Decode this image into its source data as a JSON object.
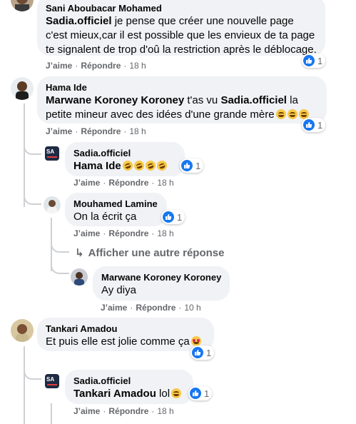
{
  "comments": [
    {
      "author": "Sani Aboubacar Mohamed",
      "lines": [
        [
          {
            "t": "Sadia.officiel",
            "m": true
          },
          {
            "t": " je pense que créer une nouvelle page"
          }
        ],
        [
          {
            "t": "c'est mieux,car il est possible que les envieux de ta page"
          }
        ],
        [
          {
            "t": "te signalent de trop d'oû la restriction après le déblocage."
          }
        ]
      ],
      "like_label": "J’aime",
      "reply_label": "Répondre",
      "time": "18 h",
      "reactions": "1"
    },
    {
      "author": "Hama Ide",
      "lines": [
        [
          {
            "t": "Marwane Koroney Koroney",
            "m": true
          },
          {
            "t": " t'as vu "
          },
          {
            "t": "Sadia.officiel",
            "m": true
          },
          {
            "t": " la"
          }
        ],
        [
          {
            "t": "petite mineur avec des idées d'une grande mère"
          }
        ]
      ],
      "emojis": [
        "laugh-cry-emoji",
        "laugh-cry-emoji",
        "laugh-cry-emoji"
      ],
      "like_label": "J’aime",
      "reply_label": "Répondre",
      "time": "18 h",
      "reactions": "1"
    },
    {
      "author": "Sadia.officiel",
      "lines": [
        [
          {
            "t": "Hama Ide",
            "m": true
          }
        ]
      ],
      "emojis": [
        "rofl-emoji",
        "rofl-emoji",
        "rofl-emoji",
        "rofl-emoji"
      ],
      "like_label": "J’aime",
      "reply_label": "Répondre",
      "time": "18 h",
      "reactions": "1"
    },
    {
      "author": "Mouhamed Lamine",
      "lines": [
        [
          {
            "t": "On la écrit ça"
          }
        ]
      ],
      "like_label": "J’aime",
      "reply_label": "Répondre",
      "time": "18 h",
      "reactions": "1"
    },
    {
      "author": "Marwane Koroney Koroney",
      "lines": [
        [
          {
            "t": "Ay diya"
          }
        ]
      ],
      "like_label": "J’aime",
      "reply_label": "Répondre",
      "time": "10 h"
    },
    {
      "author": "Tankari Amadou",
      "lines": [
        [
          {
            "t": "Et puis elle est jolie comme ça"
          }
        ]
      ],
      "emojis": [
        "heart-eyes-emoji"
      ],
      "reactions": "1"
    },
    {
      "author": "Sadia.officiel",
      "lines": [
        [
          {
            "t": "Tankari Amadou",
            "m": true
          },
          {
            "t": " lol"
          }
        ]
      ],
      "emojis": [
        "laugh-cry-emoji"
      ],
      "like_label": "J’aime",
      "reply_label": "Répondre",
      "time": "18 h",
      "reactions": "1"
    }
  ],
  "more_replies_label": "Afficher une autre réponse",
  "avatar_badge": "SA",
  "colors": {
    "like_blue": "#1877f2",
    "bubble": "#f0f2f5",
    "meta_gray": "#65676b",
    "thread_line": "#ced0d4"
  }
}
